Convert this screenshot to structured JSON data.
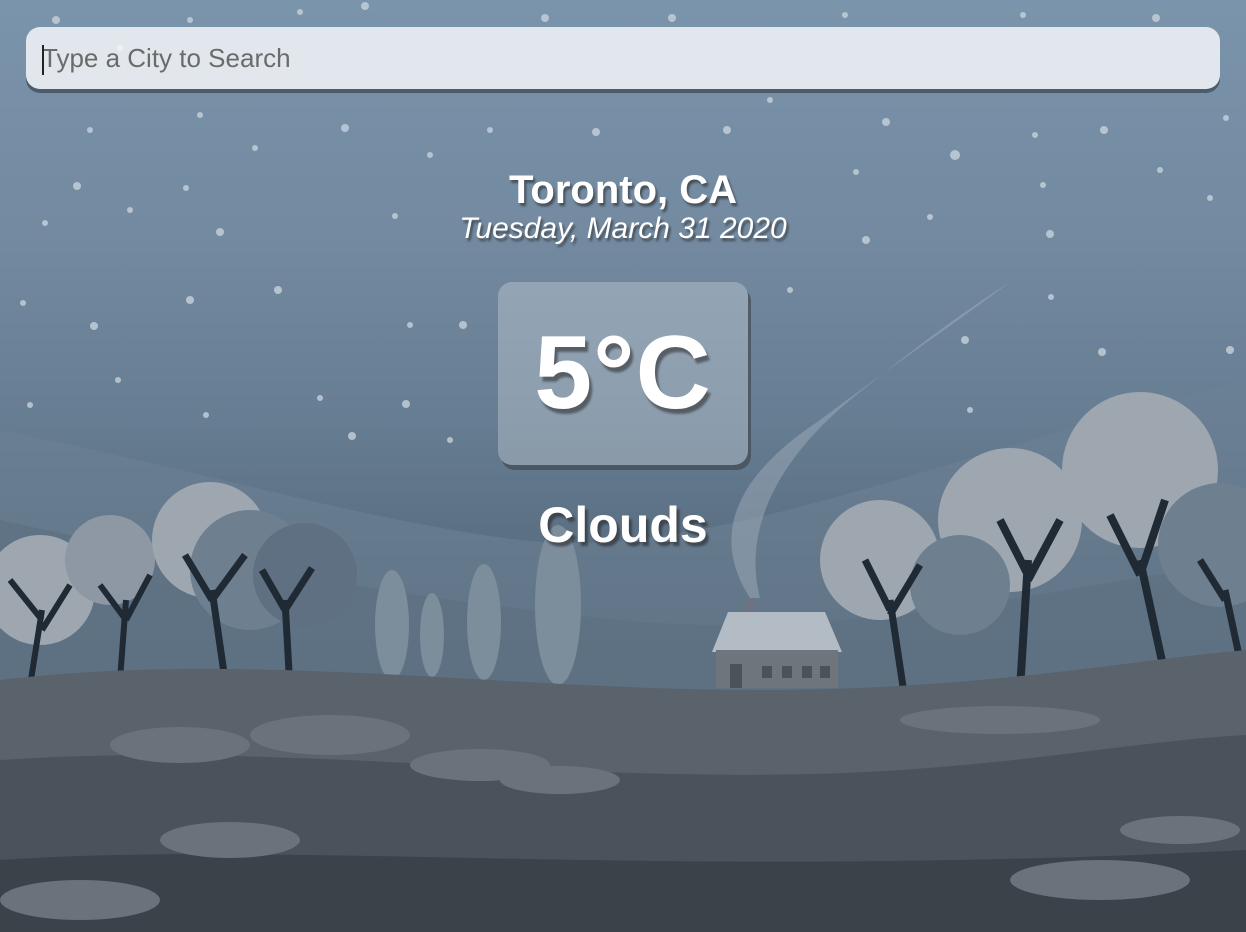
{
  "search": {
    "placeholder": "Type a City to Search",
    "value": ""
  },
  "location": {
    "city": "Toronto, CA",
    "date": "Tuesday, March 31 2020"
  },
  "weather": {
    "temperature": "5°C",
    "condition": "Clouds"
  },
  "colors": {
    "sky_top": "#7a94ab",
    "ground_dark": "#3a434d",
    "tree_light": "#9aa3ac",
    "tree_dark": "#5d6f80",
    "trunk": "#1f2a35",
    "text": "#ffffff"
  }
}
